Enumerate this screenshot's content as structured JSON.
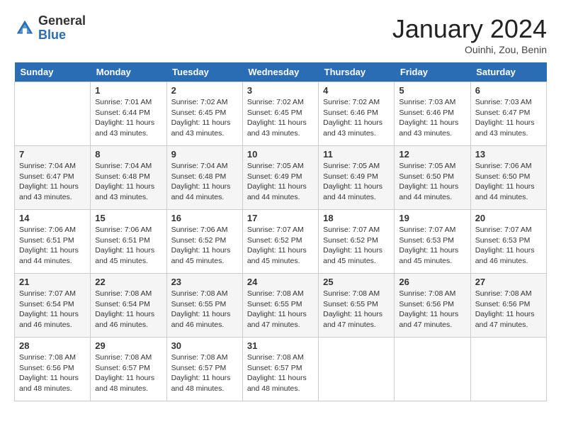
{
  "header": {
    "logo_general": "General",
    "logo_blue": "Blue",
    "month_title": "January 2024",
    "location": "Ouinhi, Zou, Benin"
  },
  "weekdays": [
    "Sunday",
    "Monday",
    "Tuesday",
    "Wednesday",
    "Thursday",
    "Friday",
    "Saturday"
  ],
  "weeks": [
    [
      {
        "day": "",
        "info": ""
      },
      {
        "day": "1",
        "info": "Sunrise: 7:01 AM\nSunset: 6:44 PM\nDaylight: 11 hours and 43 minutes."
      },
      {
        "day": "2",
        "info": "Sunrise: 7:02 AM\nSunset: 6:45 PM\nDaylight: 11 hours and 43 minutes."
      },
      {
        "day": "3",
        "info": "Sunrise: 7:02 AM\nSunset: 6:45 PM\nDaylight: 11 hours and 43 minutes."
      },
      {
        "day": "4",
        "info": "Sunrise: 7:02 AM\nSunset: 6:46 PM\nDaylight: 11 hours and 43 minutes."
      },
      {
        "day": "5",
        "info": "Sunrise: 7:03 AM\nSunset: 6:46 PM\nDaylight: 11 hours and 43 minutes."
      },
      {
        "day": "6",
        "info": "Sunrise: 7:03 AM\nSunset: 6:47 PM\nDaylight: 11 hours and 43 minutes."
      }
    ],
    [
      {
        "day": "7",
        "info": "Sunrise: 7:04 AM\nSunset: 6:47 PM\nDaylight: 11 hours and 43 minutes."
      },
      {
        "day": "8",
        "info": "Sunrise: 7:04 AM\nSunset: 6:48 PM\nDaylight: 11 hours and 43 minutes."
      },
      {
        "day": "9",
        "info": "Sunrise: 7:04 AM\nSunset: 6:48 PM\nDaylight: 11 hours and 44 minutes."
      },
      {
        "day": "10",
        "info": "Sunrise: 7:05 AM\nSunset: 6:49 PM\nDaylight: 11 hours and 44 minutes."
      },
      {
        "day": "11",
        "info": "Sunrise: 7:05 AM\nSunset: 6:49 PM\nDaylight: 11 hours and 44 minutes."
      },
      {
        "day": "12",
        "info": "Sunrise: 7:05 AM\nSunset: 6:50 PM\nDaylight: 11 hours and 44 minutes."
      },
      {
        "day": "13",
        "info": "Sunrise: 7:06 AM\nSunset: 6:50 PM\nDaylight: 11 hours and 44 minutes."
      }
    ],
    [
      {
        "day": "14",
        "info": "Sunrise: 7:06 AM\nSunset: 6:51 PM\nDaylight: 11 hours and 44 minutes."
      },
      {
        "day": "15",
        "info": "Sunrise: 7:06 AM\nSunset: 6:51 PM\nDaylight: 11 hours and 45 minutes."
      },
      {
        "day": "16",
        "info": "Sunrise: 7:06 AM\nSunset: 6:52 PM\nDaylight: 11 hours and 45 minutes."
      },
      {
        "day": "17",
        "info": "Sunrise: 7:07 AM\nSunset: 6:52 PM\nDaylight: 11 hours and 45 minutes."
      },
      {
        "day": "18",
        "info": "Sunrise: 7:07 AM\nSunset: 6:52 PM\nDaylight: 11 hours and 45 minutes."
      },
      {
        "day": "19",
        "info": "Sunrise: 7:07 AM\nSunset: 6:53 PM\nDaylight: 11 hours and 45 minutes."
      },
      {
        "day": "20",
        "info": "Sunrise: 7:07 AM\nSunset: 6:53 PM\nDaylight: 11 hours and 46 minutes."
      }
    ],
    [
      {
        "day": "21",
        "info": "Sunrise: 7:07 AM\nSunset: 6:54 PM\nDaylight: 11 hours and 46 minutes."
      },
      {
        "day": "22",
        "info": "Sunrise: 7:08 AM\nSunset: 6:54 PM\nDaylight: 11 hours and 46 minutes."
      },
      {
        "day": "23",
        "info": "Sunrise: 7:08 AM\nSunset: 6:55 PM\nDaylight: 11 hours and 46 minutes."
      },
      {
        "day": "24",
        "info": "Sunrise: 7:08 AM\nSunset: 6:55 PM\nDaylight: 11 hours and 47 minutes."
      },
      {
        "day": "25",
        "info": "Sunrise: 7:08 AM\nSunset: 6:55 PM\nDaylight: 11 hours and 47 minutes."
      },
      {
        "day": "26",
        "info": "Sunrise: 7:08 AM\nSunset: 6:56 PM\nDaylight: 11 hours and 47 minutes."
      },
      {
        "day": "27",
        "info": "Sunrise: 7:08 AM\nSunset: 6:56 PM\nDaylight: 11 hours and 47 minutes."
      }
    ],
    [
      {
        "day": "28",
        "info": "Sunrise: 7:08 AM\nSunset: 6:56 PM\nDaylight: 11 hours and 48 minutes."
      },
      {
        "day": "29",
        "info": "Sunrise: 7:08 AM\nSunset: 6:57 PM\nDaylight: 11 hours and 48 minutes."
      },
      {
        "day": "30",
        "info": "Sunrise: 7:08 AM\nSunset: 6:57 PM\nDaylight: 11 hours and 48 minutes."
      },
      {
        "day": "31",
        "info": "Sunrise: 7:08 AM\nSunset: 6:57 PM\nDaylight: 11 hours and 48 minutes."
      },
      {
        "day": "",
        "info": ""
      },
      {
        "day": "",
        "info": ""
      },
      {
        "day": "",
        "info": ""
      }
    ]
  ]
}
